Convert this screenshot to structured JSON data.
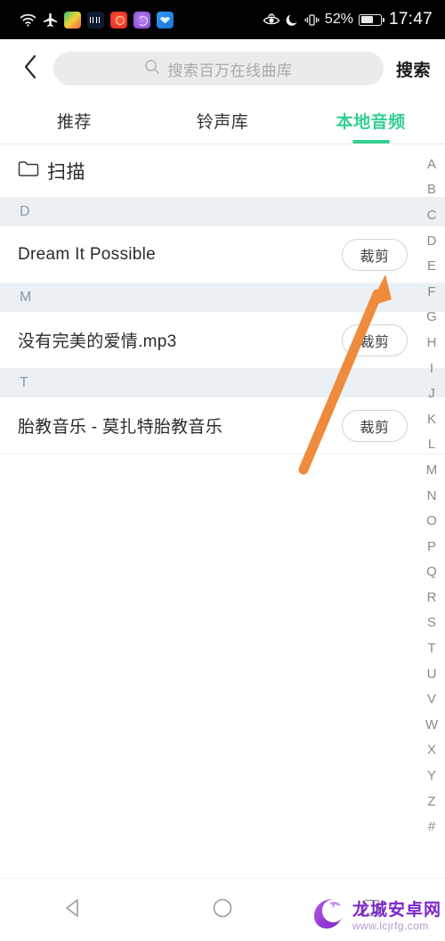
{
  "status_bar": {
    "left_icons": [
      "wifi-icon",
      "airplane-mode-icon",
      "app-icon-gallery",
      "app-icon-stocks",
      "app-icon-timer",
      "app-icon-clock",
      "app-icon-weather"
    ],
    "eye_comfort_icon": "eye-comfort-icon",
    "do_not_disturb_icon": "moon-icon",
    "vibrate_icon": "vibrate-icon",
    "battery_percent": "52%",
    "time": "17:47"
  },
  "search": {
    "back_icon": "chevron-left-icon",
    "search_icon": "search-icon",
    "placeholder": "搜索百万在线曲库",
    "value": "",
    "submit_label": "搜索"
  },
  "tabs": [
    {
      "label": "推荐",
      "active": false
    },
    {
      "label": "铃声库",
      "active": false
    },
    {
      "label": "本地音频",
      "active": true
    }
  ],
  "scan_row": {
    "icon": "folder-icon",
    "label": "扫描"
  },
  "sections": [
    {
      "letter": "D",
      "songs": [
        {
          "title": "Dream It Possible",
          "action_label": "裁剪"
        }
      ]
    },
    {
      "letter": "M",
      "songs": [
        {
          "title": "没有完美的爱情.mp3",
          "action_label": "裁剪"
        }
      ]
    },
    {
      "letter": "T",
      "songs": [
        {
          "title": "胎教音乐 - 莫扎特胎教音乐",
          "action_label": "裁剪"
        }
      ]
    }
  ],
  "alpha_index": [
    "A",
    "B",
    "C",
    "D",
    "E",
    "F",
    "G",
    "H",
    "I",
    "J",
    "K",
    "L",
    "M",
    "N",
    "O",
    "P",
    "Q",
    "R",
    "S",
    "T",
    "U",
    "V",
    "W",
    "X",
    "Y",
    "Z",
    "#"
  ],
  "nav_bar": {
    "back_icon": "nav-back-triangle-icon",
    "home_icon": "nav-home-circle-icon",
    "recents_icon": "nav-recents-square-icon"
  },
  "watermark": {
    "logo": "dragon-logo-icon",
    "title": "龙城安卓网",
    "url": "www.lcjrfg.com"
  },
  "annotation": {
    "arrow_color": "#ef8b3c",
    "points_to": "crop-button-first-song"
  },
  "colors": {
    "accent_green": "#35cf91",
    "section_header_bg": "#eaf0f3",
    "search_field_bg": "#ebebeb",
    "status_bar_bg": "#000000",
    "arrow_orange": "#ef8b3c",
    "watermark_purple": "#7b27c9"
  }
}
